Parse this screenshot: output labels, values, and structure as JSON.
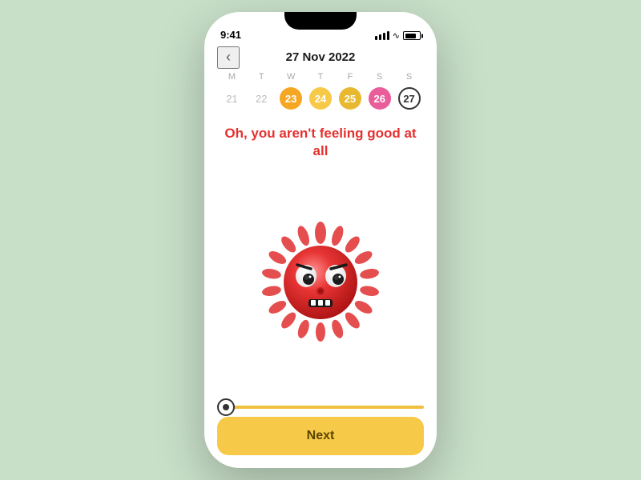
{
  "app": {
    "background_color": "#c8dfc8"
  },
  "status_bar": {
    "time": "9:41"
  },
  "header": {
    "back_label": "‹",
    "title": "27 Nov 2022"
  },
  "calendar": {
    "day_names": [
      "M",
      "T",
      "W",
      "T",
      "F",
      "S",
      "S"
    ],
    "dates": [
      {
        "value": "21",
        "style": "inactive"
      },
      {
        "value": "22",
        "style": "inactive"
      },
      {
        "value": "23",
        "style": "orange"
      },
      {
        "value": "24",
        "style": "yellow"
      },
      {
        "value": "25",
        "style": "gold"
      },
      {
        "value": "26",
        "style": "pink"
      },
      {
        "value": "27",
        "style": "outline"
      }
    ]
  },
  "mood": {
    "text": "Oh, you aren't feeling good at all"
  },
  "slider": {
    "value": 0,
    "min": 0,
    "max": 100
  },
  "button": {
    "next_label": "Next"
  }
}
